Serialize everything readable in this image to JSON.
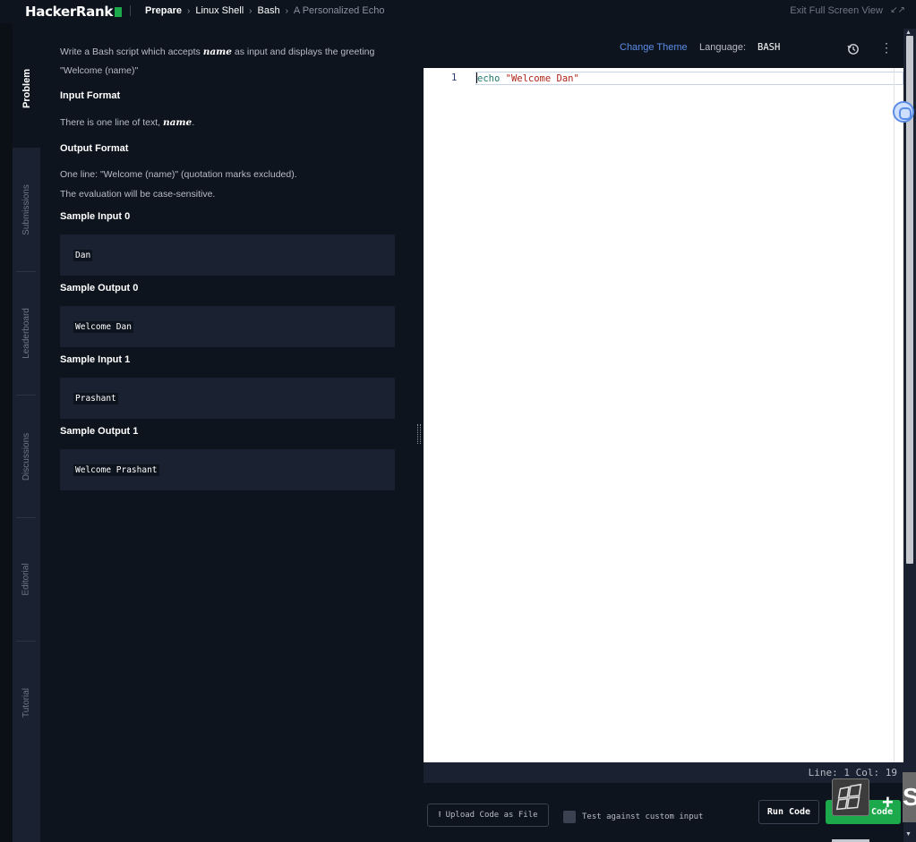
{
  "header": {
    "logo": "HackerRank",
    "breadcrumb": [
      "Prepare",
      "Linux Shell",
      "Bash",
      "A Personalized Echo"
    ],
    "exit_fullscreen": "Exit Full Screen View"
  },
  "rail": {
    "tabs": [
      "Problem",
      "Submissions",
      "Leaderboard",
      "Discussions",
      "Editorial",
      "Tutorial"
    ],
    "active": "Problem"
  },
  "problem": {
    "intro_1_a": "Write a Bash script which accepts ",
    "intro_1_var": "name",
    "intro_1_b": " as input and displays the greeting",
    "intro_2": "\"Welcome (name)\"",
    "input_format_title": "Input Format",
    "input_format_a": "There is one line of text, ",
    "input_format_var": "name",
    "input_format_b": ".",
    "output_format_title": "Output Format",
    "output_format_1": "One line: \"Welcome (name)\" (quotation marks excluded).",
    "output_format_2": "The evaluation will be case-sensitive.",
    "samples": [
      {
        "title": "Sample Input 0",
        "value": "Dan"
      },
      {
        "title": "Sample Output 0",
        "value": "Welcome Dan"
      },
      {
        "title": "Sample Input 1",
        "value": "Prashant"
      },
      {
        "title": "Sample Output 1",
        "value": "Welcome Prashant"
      }
    ]
  },
  "editor": {
    "change_theme": "Change Theme",
    "language_label": "Language:",
    "language": "BASH",
    "line_number": "1",
    "code_keyword": "echo",
    "code_string": "\"Welcome Dan\"",
    "status": "Line: 1 Col: 19"
  },
  "actions": {
    "upload": "Upload Code as File",
    "custom_input": "Test against custom input",
    "run": "Run Code",
    "submit": "Submit Code"
  },
  "colors": {
    "brand_green": "#1ba94c",
    "link_blue": "#5b8de6",
    "background": "#0e141e"
  }
}
